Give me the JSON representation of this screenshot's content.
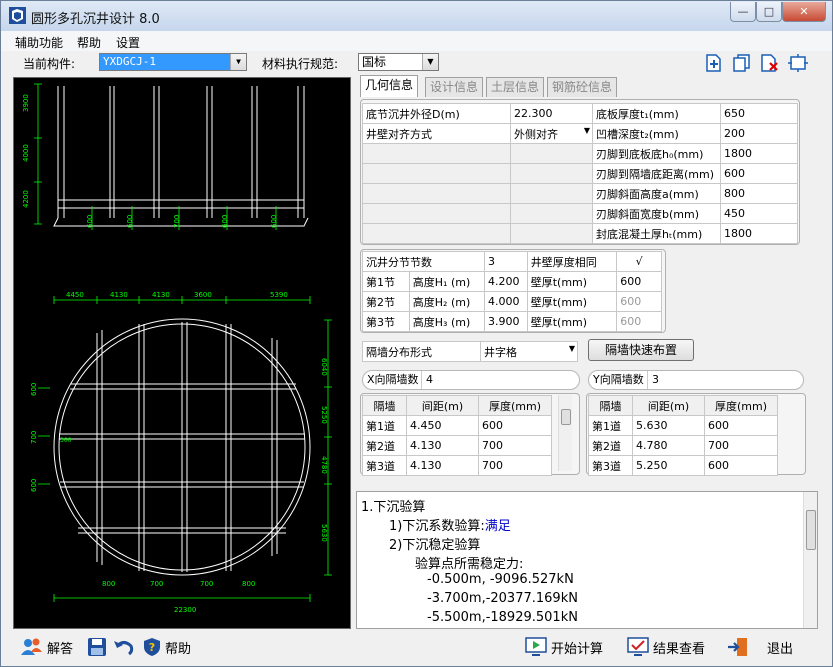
{
  "window": {
    "title": "圆形多孔沉井设计 8.0"
  },
  "menu": [
    "辅助功能",
    "帮助",
    "设置"
  ],
  "toolbar": {
    "component_label": "当前构件:",
    "component_value": "YXDGCJ-1",
    "standard_label": "材料执行规范:",
    "standard_value": "国标"
  },
  "tabs": [
    "几何信息",
    "设计信息",
    "土层信息",
    "钢筋砼信息"
  ],
  "geom_table": {
    "rows": [
      [
        "底节沉井外径D(m)",
        "22.300",
        "底板厚度t₁(mm)",
        "650"
      ],
      [
        "井壁对齐方式",
        "外侧对齐",
        "凹槽深度t₂(mm)",
        "200"
      ],
      [
        "",
        "",
        "刃脚到底板底h₀(mm)",
        "1800"
      ],
      [
        "",
        "",
        "刃脚到隔墙底距离(mm)",
        "600"
      ],
      [
        "",
        "",
        "刃脚斜面高度a(mm)",
        "800"
      ],
      [
        "",
        "",
        "刃脚斜面宽度b(mm)",
        "450"
      ],
      [
        "",
        "",
        "封底混凝土厚hₜ(mm)",
        "1800"
      ]
    ]
  },
  "segments": {
    "count_label": "沉井分节节数",
    "count_value": "3",
    "same_label": "井壁厚度相同",
    "same_check": "√",
    "rows": [
      [
        "第1节",
        "高度H₁ (m)",
        "4.200",
        "壁厚t(mm)",
        "600"
      ],
      [
        "第2节",
        "高度H₂ (m)",
        "4.000",
        "壁厚t(mm)",
        "600"
      ],
      [
        "第3节",
        "高度H₃ (m)",
        "3.900",
        "壁厚t(mm)",
        "600"
      ]
    ]
  },
  "partition": {
    "form_label": "隔墙分布形式",
    "form_value": "井字格",
    "quick_button": "隔墙快速布置",
    "x_count_label": "X向隔墙数",
    "x_count": "4",
    "y_count_label": "Y向隔墙数",
    "y_count": "3",
    "headers": [
      "隔墙",
      "间距(m)",
      "厚度(mm)"
    ],
    "x_rows": [
      [
        "第1道",
        "4.450",
        "600"
      ],
      [
        "第2道",
        "4.130",
        "700"
      ],
      [
        "第3道",
        "4.130",
        "700"
      ]
    ],
    "y_rows": [
      [
        "第1道",
        "5.630",
        "600"
      ],
      [
        "第2道",
        "4.780",
        "700"
      ],
      [
        "第3道",
        "5.250",
        "600"
      ]
    ]
  },
  "results": [
    {
      "text": "1.下沉验算",
      "indent": 0
    },
    {
      "text": "1)下沉系数验算:",
      "extra": "满足",
      "indent": 2
    },
    {
      "text": "2)下沉稳定验算",
      "indent": 2
    },
    {
      "text": "验算点所需稳定力:",
      "indent": 3
    },
    {
      "text": "-0.500m, -9096.527kN",
      "indent": 4
    },
    {
      "text": "-3.700m,-20377.169kN",
      "indent": 4
    },
    {
      "text": "-5.500m,-18929.501kN",
      "indent": 4
    }
  ],
  "drawing": {
    "elev_dims": [
      "3900",
      "4000",
      "4200"
    ],
    "elev_wall_dims": [
      "600",
      "600",
      "700",
      "600",
      "600"
    ],
    "top_dims": [
      "4450",
      "4130",
      "4130",
      "3600",
      "5390"
    ],
    "right_dims": [
      "6040",
      "5250",
      "4780",
      "5630"
    ],
    "left_dims": [
      "600",
      "700",
      "600"
    ],
    "center_dim": "300",
    "bottom_small_dims": [
      "800",
      "700",
      "700",
      "800"
    ],
    "bottom_dim": "22300"
  },
  "statusbar": {
    "answer": "解答",
    "help": "帮助",
    "start": "开始计算",
    "view": "结果查看",
    "exit": "退出"
  },
  "colors": {
    "drawing_bg": "#000000",
    "dim_green": "#00ff00",
    "line_white": "#ffffff",
    "link_blue": "#0000cc"
  }
}
